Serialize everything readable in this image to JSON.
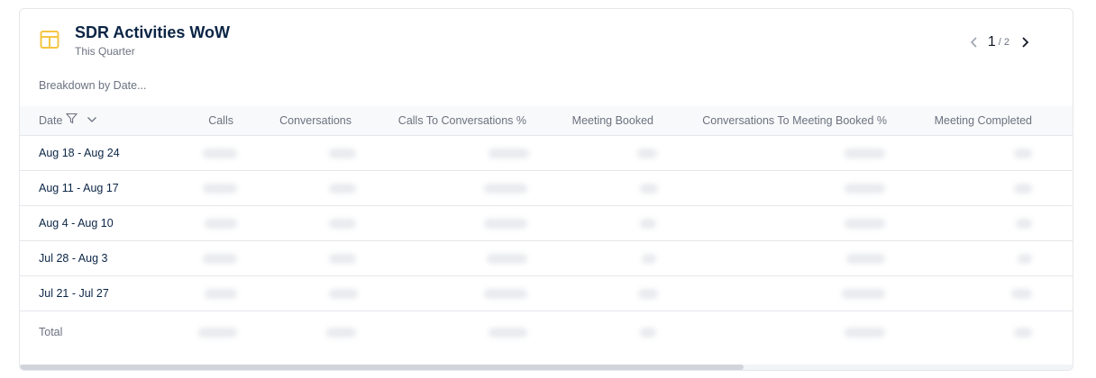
{
  "widget": {
    "title": "SDR Activities WoW",
    "subtitle": "This Quarter",
    "icon": "table-icon",
    "accent_color": "#f5c542"
  },
  "pager": {
    "current": "1",
    "total": "/ 2"
  },
  "breakdown_label": "Breakdown by Date...",
  "table": {
    "columns": [
      "Date",
      "Calls",
      "Conversations",
      "Calls To Conversations %",
      "Meeting Booked",
      "Conversations To Meeting Booked %",
      "Meeting Completed"
    ],
    "rows": [
      {
        "date": "Aug 18 - Aug 24"
      },
      {
        "date": "Aug 11 - Aug 17"
      },
      {
        "date": "Aug 4 - Aug 10"
      },
      {
        "date": "Jul 28 - Aug 3"
      },
      {
        "date": "Jul 21 - Jul 27"
      }
    ],
    "total_label": "Total"
  }
}
